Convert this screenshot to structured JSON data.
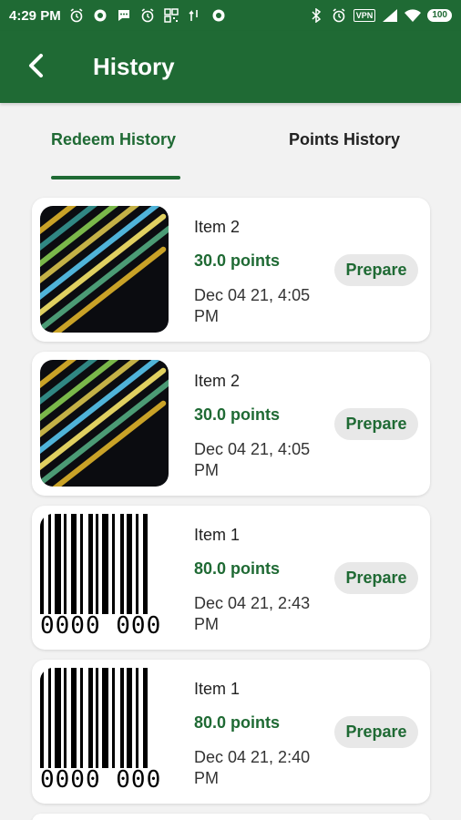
{
  "status_bar": {
    "time": "4:29 PM",
    "vpn": "VPN",
    "battery": "100"
  },
  "app_bar": {
    "title": "History",
    "back_icon": "arrow-back-icon"
  },
  "tabs": [
    {
      "label": "Redeem History",
      "active": true
    },
    {
      "label": "Points History",
      "active": false
    }
  ],
  "history": [
    {
      "name": "Item 2",
      "points": "30.0 points",
      "date": "Dec 04 21, 4:05 PM",
      "status": "Prepare",
      "thumbnail": "code"
    },
    {
      "name": "Item 2",
      "points": "30.0 points",
      "date": "Dec 04 21, 4:05 PM",
      "status": "Prepare",
      "thumbnail": "code"
    },
    {
      "name": "Item 1",
      "points": "80.0 points",
      "date": "Dec 04 21, 2:43 PM",
      "status": "Prepare",
      "thumbnail": "barcode"
    },
    {
      "name": "Item 1",
      "points": "80.0 points",
      "date": "Dec 04 21, 2:40 PM",
      "status": "Prepare",
      "thumbnail": "barcode"
    }
  ],
  "barcode_digits": "0000 000",
  "colors": {
    "primary": "#1f6a34",
    "background": "#f2f2f2",
    "chip": "#e8e8e8"
  }
}
